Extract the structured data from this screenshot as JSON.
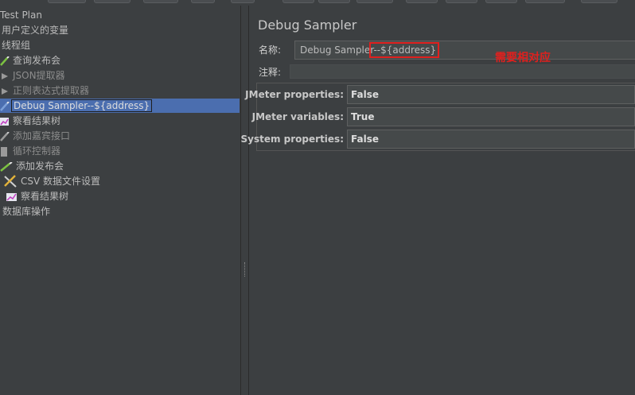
{
  "tree": {
    "items": [
      {
        "label": "Test Plan",
        "icon": "test-plan-icon"
      },
      {
        "label": "用户定义的变量",
        "icon": "variables-icon"
      },
      {
        "label": "线程组",
        "icon": "thread-group-icon"
      },
      {
        "label": "查询发布会",
        "icon": "sampler-pencil-icon"
      },
      {
        "label": "JSON提取器",
        "icon": "extractor-icon"
      },
      {
        "label": "正则表达式提取器",
        "icon": "extractor-icon"
      },
      {
        "label": "Debug Sampler--${address}",
        "icon": "sampler-pencil-icon"
      },
      {
        "label": "察看结果树",
        "icon": "listener-chart-icon"
      },
      {
        "label": "添加嘉宾接口",
        "icon": "sampler-pencil-icon"
      },
      {
        "label": "循环控制器",
        "icon": "controller-icon"
      },
      {
        "label": "添加发布会",
        "icon": "sampler-pencil-icon"
      },
      {
        "label": "CSV 数据文件设置",
        "icon": "config-tools-icon"
      },
      {
        "label": "察看结果树",
        "icon": "listener-chart-icon"
      },
      {
        "label": "数据库操作",
        "icon": "thread-group-icon"
      }
    ]
  },
  "panel": {
    "title": "Debug Sampler",
    "name_label": "名称:",
    "name_value": "Debug Sampler--${address}",
    "comment_label": "注释:",
    "comment_value": "",
    "annotation": "需要相对应",
    "properties": [
      {
        "label": "JMeter properties:",
        "value": "False"
      },
      {
        "label": "JMeter variables:",
        "value": "True"
      },
      {
        "label": "System properties:",
        "value": "False"
      }
    ]
  },
  "colors": {
    "background": "#3c3f41",
    "selection": "#4b6eaf",
    "annotation_red": "#e0201e",
    "field": "#45494a"
  }
}
